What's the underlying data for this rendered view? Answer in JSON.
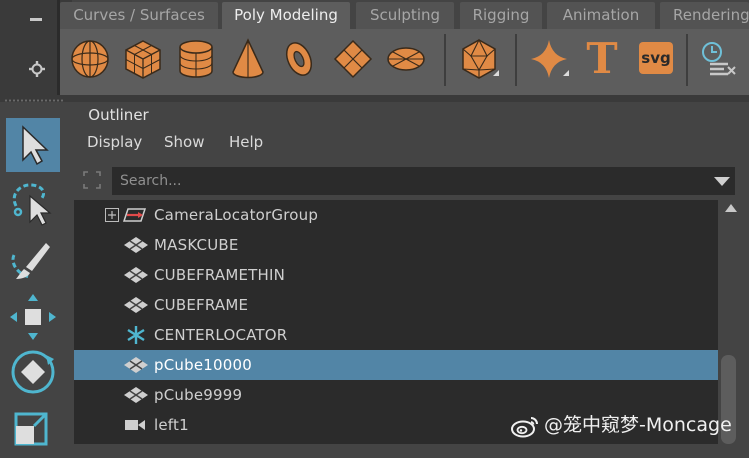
{
  "shelf": {
    "tabs": [
      {
        "label": "Curves / Surfaces",
        "active": false
      },
      {
        "label": "Poly Modeling",
        "active": true
      },
      {
        "label": "Sculpting",
        "active": false
      },
      {
        "label": "Rigging",
        "active": false
      },
      {
        "label": "Animation",
        "active": false
      },
      {
        "label": "Rendering",
        "active": false
      }
    ],
    "buttons": [
      "poly-sphere-icon",
      "poly-cube-icon",
      "poly-cylinder-icon",
      "poly-cone-icon",
      "poly-torus-icon",
      "poly-plane-icon",
      "poly-disc-icon",
      "platonic-solid-icon",
      "super-shape-icon",
      "type-icon",
      "svg-icon",
      "time-editor-icon"
    ],
    "type_label": "T",
    "svg_label": "svg",
    "accent_color": "#e08a45"
  },
  "toolbox": {
    "tools": [
      "select-tool-icon",
      "lasso-tool-icon",
      "paint-select-tool-icon",
      "move-tool-icon",
      "rotate-tool-icon",
      "scale-tool-icon"
    ],
    "active_index": 0,
    "active_color": "#5285a6"
  },
  "outliner": {
    "tab_label": "Outliner",
    "menu": [
      "Display",
      "Show",
      "Help"
    ],
    "search_placeholder": "Search...",
    "items": [
      {
        "label": "CameraLocatorGroup",
        "icon": "group-camera-icon",
        "expandable": true,
        "selected": false
      },
      {
        "label": "MASKCUBE",
        "icon": "mesh-icon",
        "expandable": false,
        "selected": false
      },
      {
        "label": "CUBEFRAMETHIN",
        "icon": "mesh-icon",
        "expandable": false,
        "selected": false
      },
      {
        "label": "CUBEFRAME",
        "icon": "mesh-icon",
        "expandable": false,
        "selected": false
      },
      {
        "label": "CENTERLOCATOR",
        "icon": "locator-icon",
        "expandable": false,
        "selected": false
      },
      {
        "label": "pCube10000",
        "icon": "mesh-icon",
        "expandable": false,
        "selected": true
      },
      {
        "label": "pCube9999",
        "icon": "mesh-icon",
        "expandable": false,
        "selected": false
      },
      {
        "label": "left1",
        "icon": "camera-icon",
        "expandable": false,
        "selected": false
      }
    ],
    "selection_color": "#5285a6"
  },
  "watermark": {
    "text": "@笼中窥梦-Moncage"
  }
}
